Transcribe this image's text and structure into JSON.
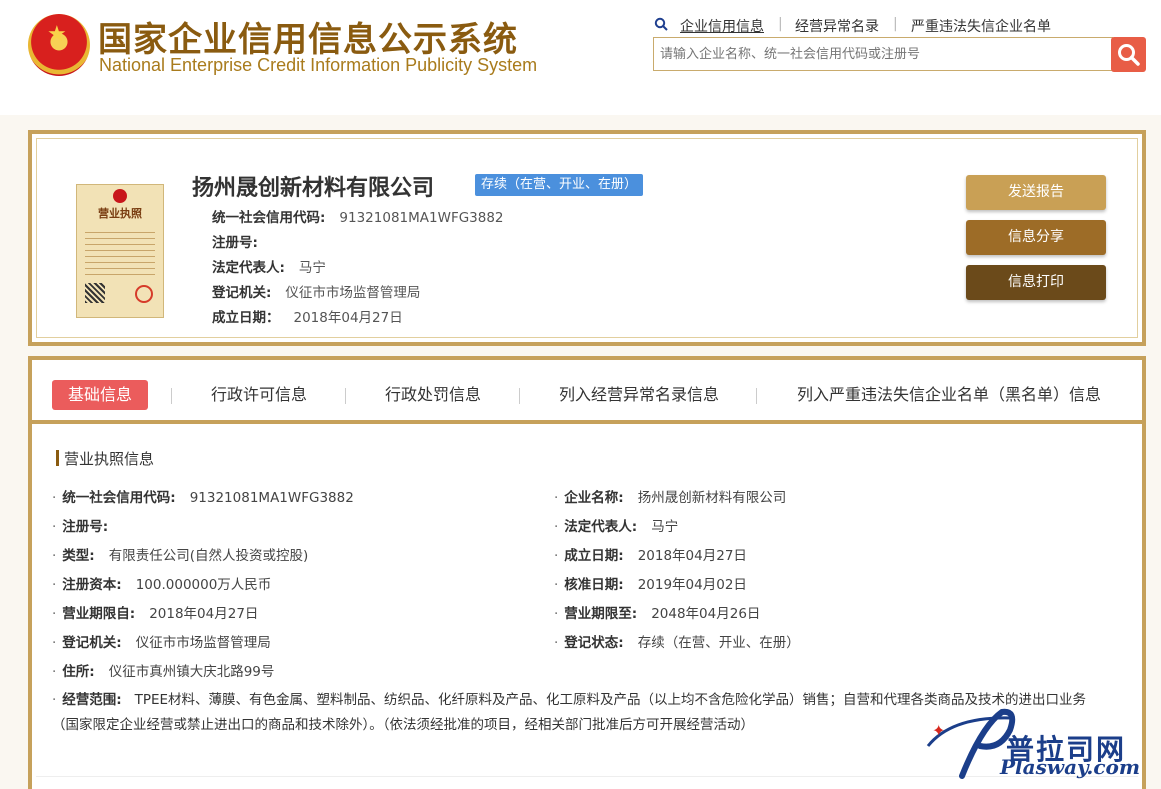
{
  "header": {
    "title_cn": "国家企业信用信息公示系统",
    "title_en": "National Enterprise Credit Information Publicity System",
    "links": [
      "企业信用信息",
      "经营异常名录",
      "严重违法失信企业名单"
    ],
    "search_placeholder": "请输入企业名称、统一社会信用代码或注册号",
    "license_title": "营业执照"
  },
  "company": {
    "name": "扬州晟创新材料有限公司",
    "status": "存续（在营、开业、在册）",
    "fields": [
      {
        "label": "统一社会信用代码:",
        "value": "91321081MA1WFG3882"
      },
      {
        "label": "注册号:",
        "value": ""
      },
      {
        "label": "法定代表人:",
        "value": "马宁"
      },
      {
        "label": "登记机关:",
        "value": "仪征市市场监督管理局"
      },
      {
        "label": "成立日期：",
        "value": "2018年04月27日"
      }
    ]
  },
  "buttons": {
    "report": "发送报告",
    "share": "信息分享",
    "print": "信息打印"
  },
  "tabs": [
    "基础信息",
    "行政许可信息",
    "行政处罚信息",
    "列入经营异常名录信息",
    "列入严重违法失信企业名单（黑名单）信息"
  ],
  "section_title": "营业执照信息",
  "details_left": [
    {
      "label": "统一社会信用代码:",
      "value": "91321081MA1WFG3882"
    },
    {
      "label": "注册号:",
      "value": ""
    },
    {
      "label": "类型:",
      "value": "有限责任公司(自然人投资或控股)"
    },
    {
      "label": "注册资本:",
      "value": "100.000000万人民币"
    },
    {
      "label": "营业期限自:",
      "value": "2018年04月27日"
    },
    {
      "label": "登记机关:",
      "value": "仪征市市场监督管理局"
    },
    {
      "label": "住所:",
      "value": "仪征市真州镇大庆北路99号"
    }
  ],
  "details_right": [
    {
      "label": "企业名称:",
      "value": "扬州晟创新材料有限公司"
    },
    {
      "label": "法定代表人:",
      "value": "马宁"
    },
    {
      "label": "成立日期:",
      "value": "2018年04月27日"
    },
    {
      "label": "核准日期:",
      "value": "2019年04月02日"
    },
    {
      "label": "营业期限至:",
      "value": "2048年04月26日"
    },
    {
      "label": "登记状态:",
      "value": "存续（在营、开业、在册）"
    }
  ],
  "scope": {
    "label": "经营范围:",
    "value": "TPEE材料、薄膜、有色金属、塑料制品、纺织品、化纤原料及产品、化工原料及产品（以上均不含危险化学品）销售；自营和代理各类商品及技术的进出口业务（国家限定企业经营或禁止进出口的商品和技术除外）。（依法须经批准的项目，经相关部门批准后方可开展经营活动）"
  },
  "watermark": {
    "cn": "普拉司网",
    "en": "Plasway.com"
  },
  "colors": {
    "gold": "#c6a15b",
    "brown": "#8a5b10",
    "active_tab": "#eb5c5c",
    "badge": "#4b90dd",
    "search_button": "#e85d46"
  }
}
